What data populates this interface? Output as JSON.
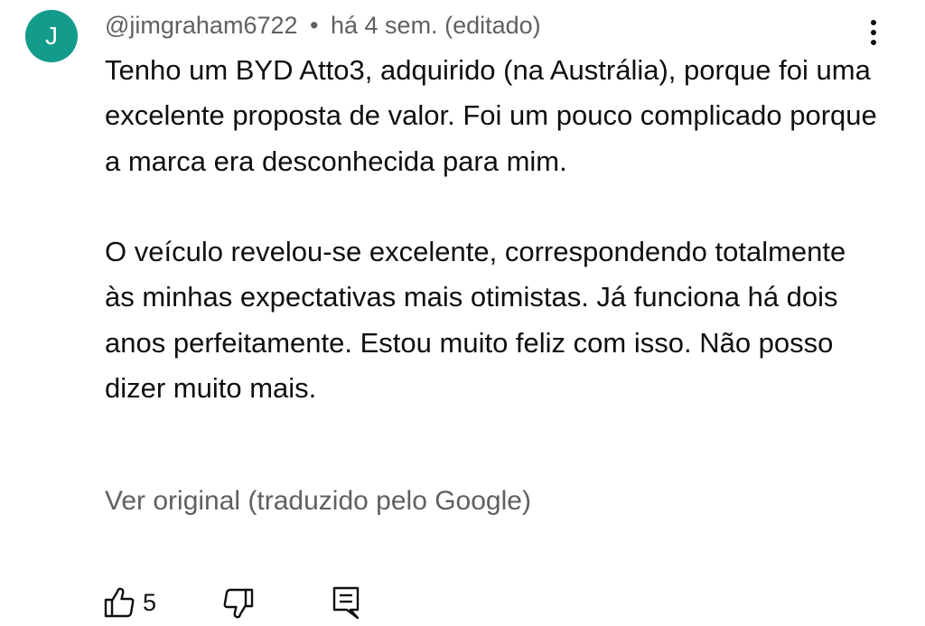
{
  "comment": {
    "avatar_letter": "J",
    "avatar_color": "#139b8b",
    "author": "@jimgraham6722",
    "separator": "•",
    "time": "há 4 sem.",
    "edited": "(editado)",
    "paragraphs": [
      "Tenho um BYD Atto3, adquirido (na Austrália), porque foi uma excelente proposta de valor. Foi um pouco complicado porque a marca era desconhecida para mim.",
      "O veículo revelou-se excelente, correspondendo totalmente às minhas expectativas mais otimistas. Já funciona há dois anos perfeitamente. Estou muito feliz com isso. Não posso dizer muito mais."
    ],
    "translation_link": "Ver original (traduzido pelo Google)",
    "like_count": "5"
  },
  "icons": {
    "more": "more-vertical-icon",
    "like": "thumbs-up-icon",
    "dislike": "thumbs-down-icon",
    "reply": "reply-comment-icon"
  }
}
